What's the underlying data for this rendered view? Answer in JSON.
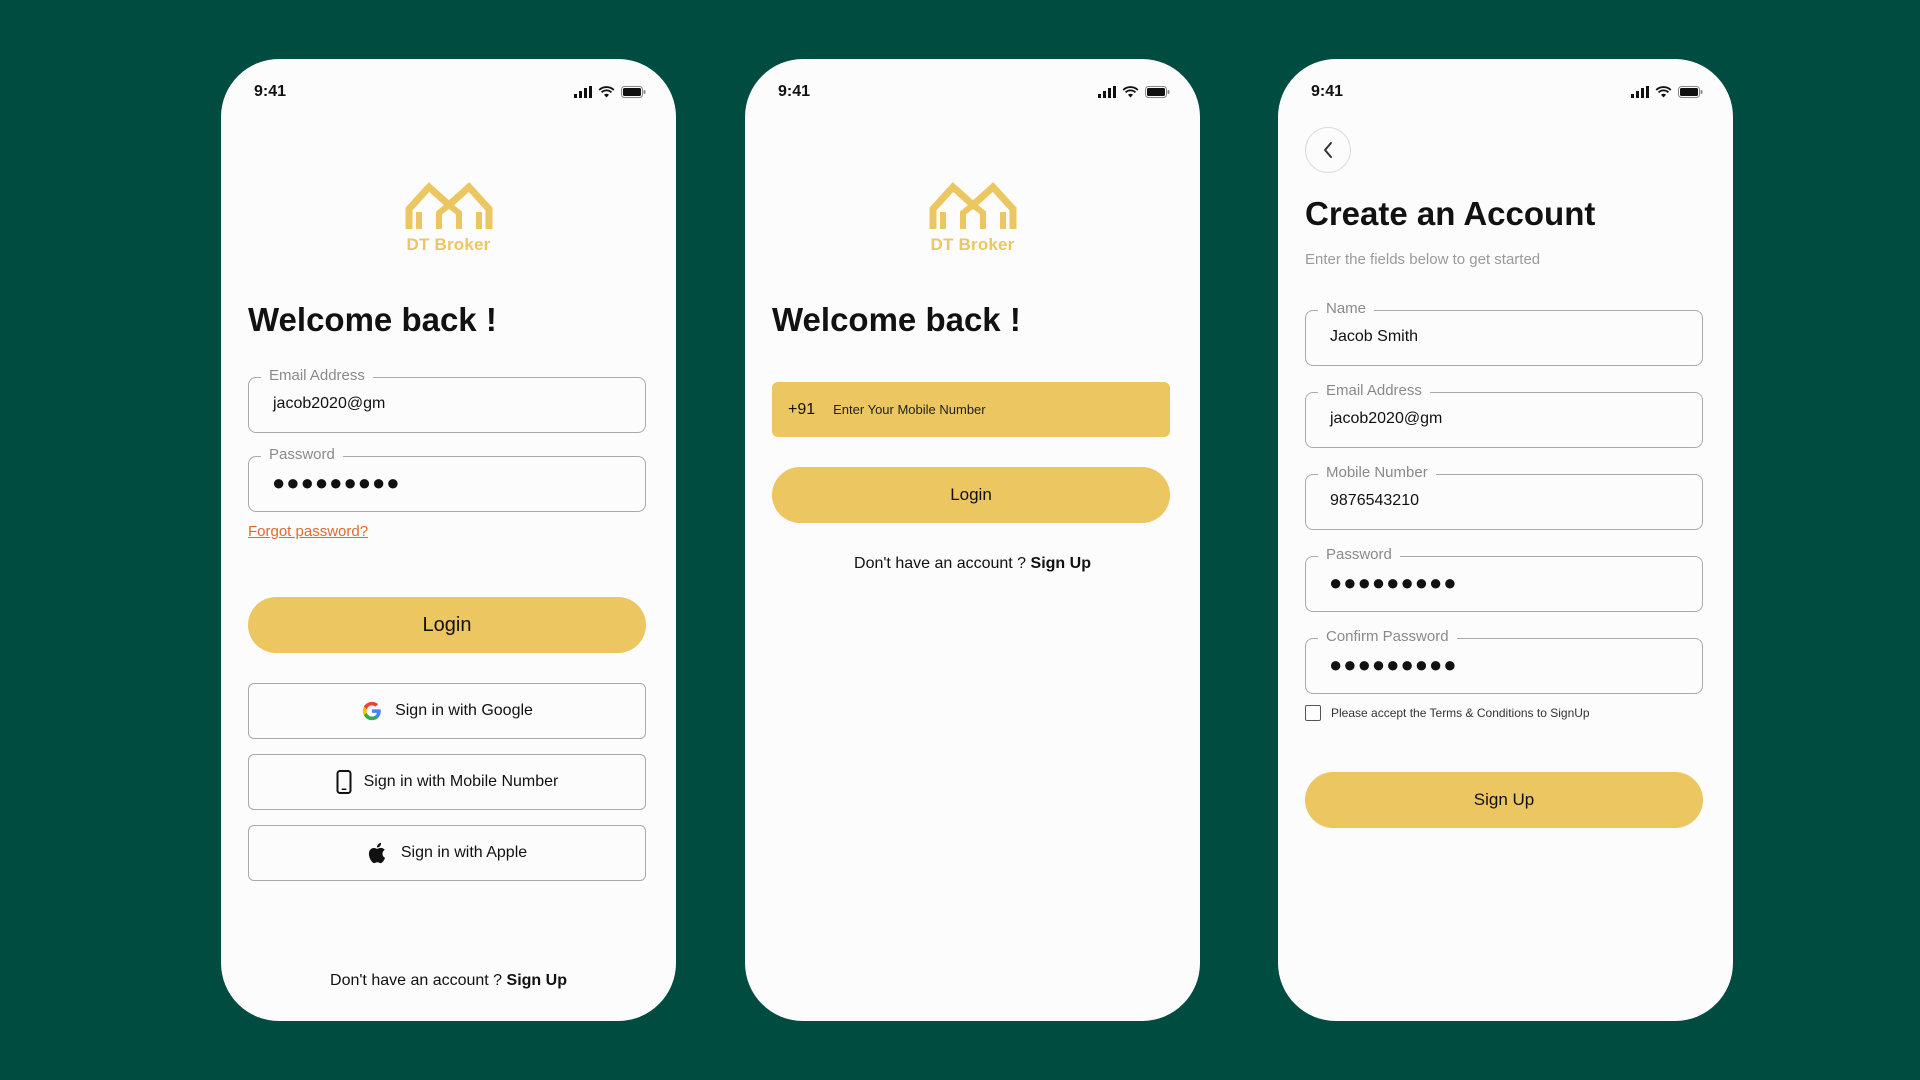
{
  "status": {
    "time": "9:41"
  },
  "brand": {
    "name": "DT Broker",
    "color": "#ecc660"
  },
  "login_screen": {
    "heading": "Welcome back !",
    "email": {
      "label": "Email Address",
      "value": "jacob2020@gm"
    },
    "password": {
      "label": "Password",
      "value": "●●●●●●●●●"
    },
    "forgot": "Forgot password?",
    "login_button": "Login",
    "google_button": "Sign in with Google",
    "mobile_button": "Sign in with Mobile Number",
    "apple_button": "Sign in with Apple",
    "footer_prefix": "Don't have an account ?",
    "footer_link": "Sign Up"
  },
  "mobile_screen": {
    "heading": "Welcome back !",
    "country_code": "+91",
    "phone_placeholder": "Enter Your Mobile Number",
    "login_button": "Login",
    "footer_prefix": "Don't have an account ?",
    "footer_link": "Sign Up"
  },
  "signup_screen": {
    "heading": "Create an Account",
    "subheading": "Enter the fields below to get started",
    "name": {
      "label": "Name",
      "value": "Jacob Smith"
    },
    "email": {
      "label": "Email Address",
      "value": "jacob2020@gm"
    },
    "mobile": {
      "label": "Mobile Number",
      "value": "9876543210"
    },
    "password": {
      "label": "Password",
      "value": "●●●●●●●●●"
    },
    "confirm_password": {
      "label": "Confirm Password",
      "value": "●●●●●●●●●"
    },
    "terms": "Please accept the Terms & Conditions to SignUp",
    "signup_button": "Sign Up"
  },
  "colors": {
    "background": "#004c40",
    "accent": "#ecc660",
    "link": "#e06a2c"
  }
}
